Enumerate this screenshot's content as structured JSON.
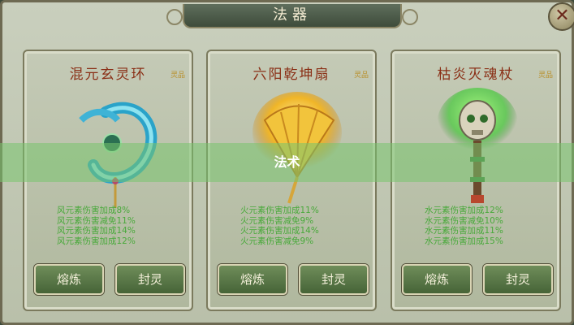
{
  "window": {
    "title": "法器",
    "close_icon": "close-icon"
  },
  "cards": [
    {
      "name": "混元玄灵环",
      "tag": "灵品",
      "stats": [
        "风元素伤害加成8%",
        "风元素伤害减免11%",
        "风元素伤害加成14%",
        "风元素伤害加成12%"
      ],
      "buttons": [
        "熔炼",
        "封灵"
      ]
    },
    {
      "name": "六阳乾坤扇",
      "tag": "灵品",
      "stats": [
        "火元素伤害加成11%",
        "火元素伤害减免9%",
        "火元素伤害加成14%",
        "火元素伤害减免9%"
      ],
      "buttons": [
        "熔炼",
        "封灵"
      ]
    },
    {
      "name": "枯炎灭魂杖",
      "tag": "灵品",
      "stats": [
        "水元素伤害加成12%",
        "水元素伤害减免10%",
        "水元素伤害加成11%",
        "水元素伤害加成15%"
      ],
      "buttons": [
        "熔炼",
        "封灵"
      ]
    }
  ],
  "overlay": {
    "label": "法术"
  },
  "colors": {
    "accent": "#8a2f16",
    "stat_text": "#49a93b",
    "button": "#5a7a48",
    "overlay": "#78c46e"
  }
}
